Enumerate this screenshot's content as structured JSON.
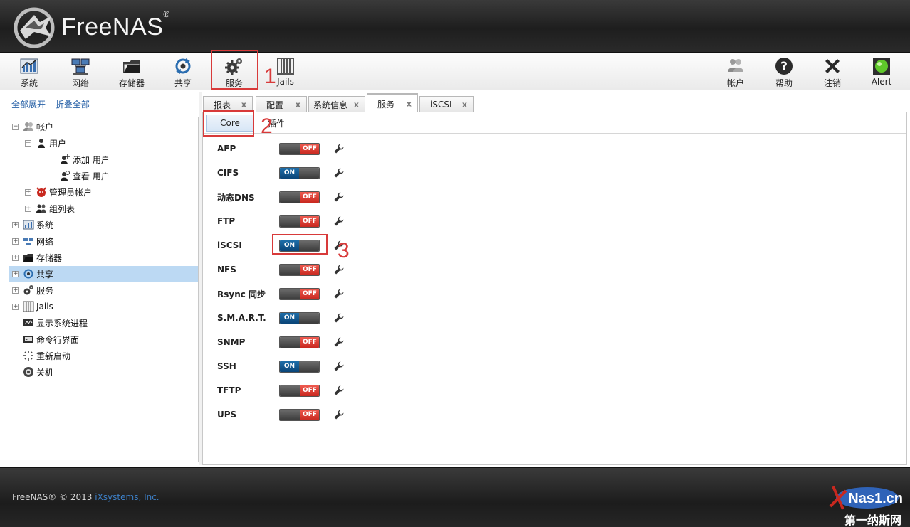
{
  "app": {
    "logo_text": "FreeNAS",
    "registered": "®"
  },
  "toolbar": {
    "left": [
      {
        "id": "system",
        "label": "系统",
        "icon": "system-chart-icon"
      },
      {
        "id": "network",
        "label": "网络",
        "icon": "network-icon"
      },
      {
        "id": "storage",
        "label": "存储器",
        "icon": "storage-icon"
      },
      {
        "id": "sharing",
        "label": "共享",
        "icon": "sharing-icon"
      },
      {
        "id": "services",
        "label": "服务",
        "icon": "gears-icon"
      },
      {
        "id": "jails",
        "label": "Jails",
        "icon": "jails-icon"
      }
    ],
    "right": [
      {
        "id": "account",
        "label": "帐户",
        "icon": "account-icon"
      },
      {
        "id": "help",
        "label": "帮助",
        "icon": "help-icon"
      },
      {
        "id": "logout",
        "label": "注销",
        "icon": "logout-icon"
      },
      {
        "id": "alert",
        "label": "Alert",
        "icon": "alert-icon"
      }
    ]
  },
  "annotations": [
    "1",
    "2",
    "3"
  ],
  "left_panel": {
    "expand_all": "全部展开",
    "collapse_all": "折叠全部",
    "tree": [
      {
        "label": "帐户",
        "level": 0,
        "expander": "−",
        "icon": "users-icon"
      },
      {
        "label": "用户",
        "level": 1,
        "expander": "−",
        "icon": "user-icon"
      },
      {
        "label": "添加 用户",
        "level": 2,
        "expander": "",
        "icon": "add-user-icon"
      },
      {
        "label": "查看 用户",
        "level": 2,
        "expander": "",
        "icon": "view-user-icon"
      },
      {
        "label": "管理员帐户",
        "level": 1,
        "expander": "+",
        "icon": "devil-icon"
      },
      {
        "label": "组列表",
        "level": 1,
        "expander": "+",
        "icon": "group-icon"
      },
      {
        "label": "系统",
        "level": 0,
        "expander": "+",
        "icon": "system-chart-icon"
      },
      {
        "label": "网络",
        "level": 0,
        "expander": "+",
        "icon": "network-icon"
      },
      {
        "label": "存储器",
        "level": 0,
        "expander": "+",
        "icon": "storage-icon"
      },
      {
        "label": "共享",
        "level": 0,
        "expander": "+",
        "icon": "sharing-icon",
        "selected": true
      },
      {
        "label": "服务",
        "level": 0,
        "expander": "+",
        "icon": "gears-icon"
      },
      {
        "label": "Jails",
        "level": 0,
        "expander": "+",
        "icon": "jails-icon"
      },
      {
        "label": "显示系统进程",
        "level": 0,
        "expander": "",
        "icon": "process-icon"
      },
      {
        "label": "命令行界面",
        "level": 0,
        "expander": "",
        "icon": "shell-icon"
      },
      {
        "label": "重新启动",
        "level": 0,
        "expander": "",
        "icon": "reboot-icon"
      },
      {
        "label": "关机",
        "level": 0,
        "expander": "",
        "icon": "power-icon"
      }
    ]
  },
  "tabs": [
    {
      "label": "报表",
      "active": false
    },
    {
      "label": "配置",
      "active": false
    },
    {
      "label": "系统信息",
      "active": false
    },
    {
      "label": "服务",
      "active": true
    },
    {
      "label": "iSCSI",
      "active": false
    }
  ],
  "tab_close": "x",
  "subtabs": [
    {
      "label": "Core",
      "active": true
    },
    {
      "label": "插件",
      "active": false
    }
  ],
  "services": [
    {
      "name": "AFP",
      "state": "off"
    },
    {
      "name": "CIFS",
      "state": "on"
    },
    {
      "name": "动态DNS",
      "state": "off"
    },
    {
      "name": "FTP",
      "state": "off"
    },
    {
      "name": "iSCSI",
      "state": "on"
    },
    {
      "name": "NFS",
      "state": "off"
    },
    {
      "name": "Rsync 同步",
      "state": "off"
    },
    {
      "name": "S.M.A.R.T.",
      "state": "on"
    },
    {
      "name": "SNMP",
      "state": "off"
    },
    {
      "name": "SSH",
      "state": "on"
    },
    {
      "name": "TFTP",
      "state": "off"
    },
    {
      "name": "UPS",
      "state": "off"
    }
  ],
  "toggle_labels": {
    "on": "ON",
    "off": "OFF"
  },
  "footer": {
    "copyright": "FreeNAS® © 2013 ",
    "company": "iXsystems, Inc."
  },
  "watermark": {
    "top": "Nas1.cn",
    "bottom": "第一纳斯网"
  },
  "colors": {
    "accent_blue": "#1e6ea9",
    "off_red": "#d9362c",
    "annotation_red": "#d83a3a",
    "selected_row": "#bcd9f3"
  }
}
